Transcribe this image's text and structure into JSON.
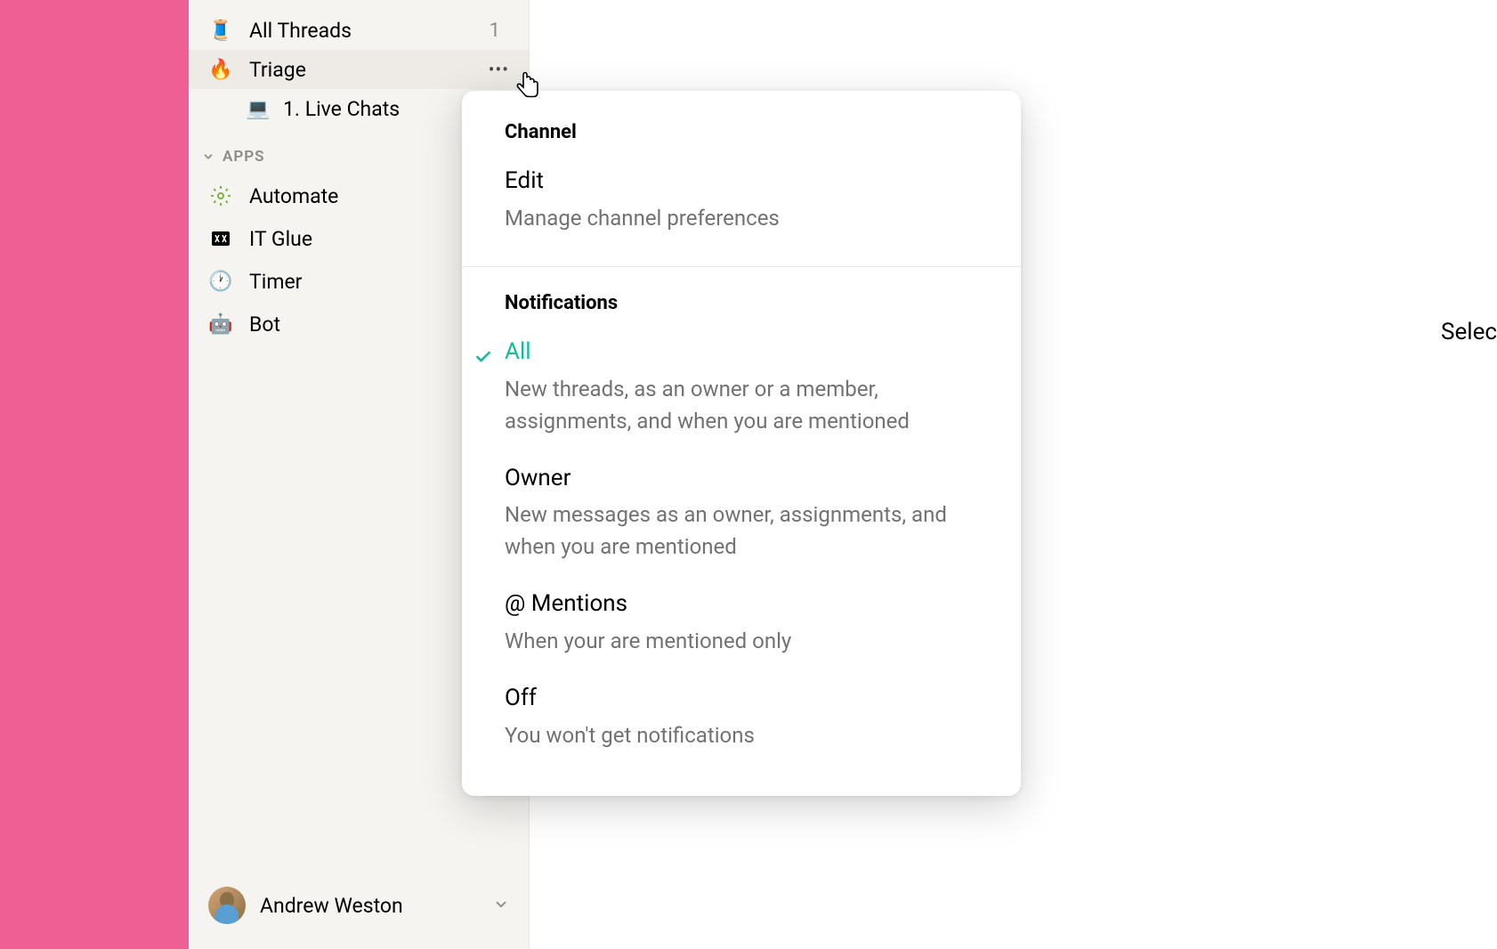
{
  "sidebar": {
    "items": [
      {
        "emoji": "🧵",
        "label": "All Threads",
        "count": "1"
      },
      {
        "emoji": "🔥",
        "label": "Triage"
      },
      {
        "emoji": "💻",
        "label": "1. Live Chats"
      }
    ],
    "apps_header": "APPS",
    "apps": [
      {
        "label": "Automate"
      },
      {
        "label": "IT Glue"
      },
      {
        "emoji": "🕐",
        "label": "Timer"
      },
      {
        "emoji": "🤖",
        "label": "Bot"
      }
    ]
  },
  "user": {
    "name": "Andrew Weston"
  },
  "popover": {
    "channel_header": "Channel",
    "edit": {
      "title": "Edit",
      "desc": "Manage channel preferences"
    },
    "notifications_header": "Notifications",
    "options": [
      {
        "title": "All",
        "desc": "New threads, as an owner or a member, assignments, and when you are mentioned",
        "active": true
      },
      {
        "title": "Owner",
        "desc": "New messages as an owner, assignments, and when you are mentioned"
      },
      {
        "title": "@ Mentions",
        "desc": "When your are mentioned only"
      },
      {
        "title": "Off",
        "desc": "You won't get notifications"
      }
    ]
  },
  "main": {
    "hint": "Selec"
  }
}
